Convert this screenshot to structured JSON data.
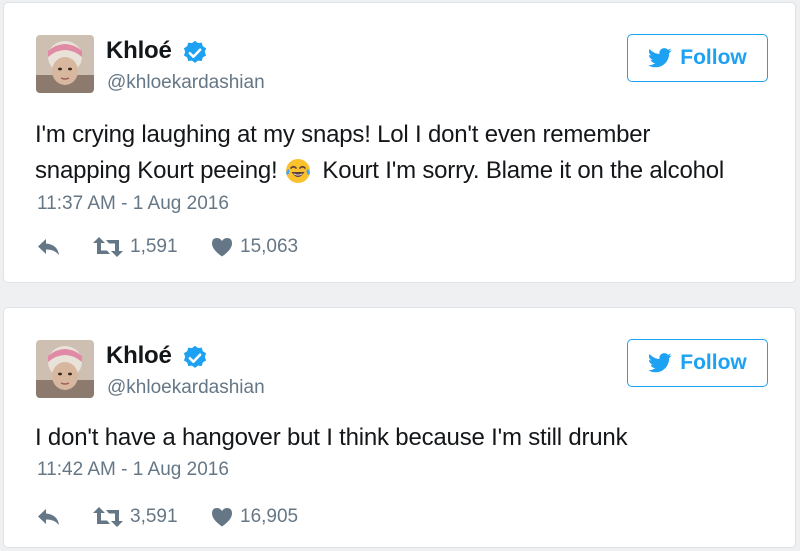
{
  "tweets": [
    {
      "author_name": "Khloé",
      "handle": "@khloekardashian",
      "follow_label": "Follow",
      "text_line1": "I'm crying laughing at my snaps! Lol I don't even remember",
      "text_line2_before": "snapping Kourt peeing!",
      "text_line2_after": "Kourt I'm sorry. Blame it on the alcohol",
      "timestamp": "11:37 AM - 1 Aug 2016",
      "retweets": "1,591",
      "likes": "15,063"
    },
    {
      "author_name": "Khloé",
      "handle": "@khloekardashian",
      "follow_label": "Follow",
      "text_line1": "I don't have a hangover but I think because I'm still drunk",
      "timestamp": "11:42 AM - 1 Aug 2016",
      "retweets": "3,591",
      "likes": "16,905"
    }
  ],
  "colors": {
    "accent": "#1da1f2",
    "muted": "#657786",
    "text": "#14171a",
    "verified": "#1da1f2"
  },
  "icons": [
    "verified-badge-icon",
    "twitter-bird-icon",
    "reply-icon",
    "retweet-icon",
    "heart-icon",
    "tears-of-joy-emoji"
  ]
}
